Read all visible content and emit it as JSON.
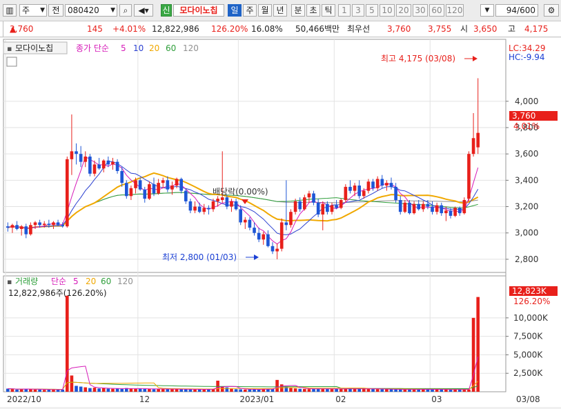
{
  "toolbar": {
    "type_label": "주",
    "prev_label": "전",
    "code": "080420",
    "new_label": "신",
    "stock_name": "모다이노칩",
    "periods": [
      "일",
      "주",
      "월",
      "년",
      "분",
      "초",
      "틱"
    ],
    "numbers": [
      "1",
      "3",
      "5",
      "10",
      "20",
      "30",
      "60",
      "120"
    ],
    "count": "94",
    "total": "/600"
  },
  "info": {
    "price": "3,760",
    "change": "145",
    "rate": "+4.01%",
    "volume": "12,822,986",
    "vol_ratio": "126.20%",
    "turnover": "16.08%",
    "amount": "50,466백만",
    "best_label": "최우선",
    "ask": "3,760",
    "bid": "3,755",
    "open_label": "시",
    "open": "3,650",
    "high_label": "고",
    "high": "4,175"
  },
  "price_panel": {
    "legend_name": "모다이노칩",
    "legend_type": "종가 단순",
    "ma_periods": [
      "5",
      "10",
      "20",
      "60",
      "120"
    ],
    "lc": "LC:34.29",
    "hc": "HC:-9.94",
    "max_annotation": "최고 4,175 (03/08)",
    "min_annotation": "최저 2,800 (01/03)",
    "ex_rights": "배당락(0.00%)",
    "current_price": "3,760",
    "current_rate": "4.01%"
  },
  "volume_panel": {
    "legend_name": "거래량",
    "legend_type": "단순",
    "ma_periods": [
      "5",
      "20",
      "60",
      "120"
    ],
    "summary": "12,822,986주(126.20%)",
    "current_volume": "12,823K",
    "current_rate": "126.20%"
  },
  "colors": {
    "up": "#e8201b",
    "down": "#1e56d6",
    "ma5": "#d61ab8",
    "ma10": "#2a3fd0",
    "ma20": "#f0a800",
    "ma60": "#2e9e3a",
    "ma120": "#909090"
  },
  "chart_data": [
    {
      "type": "candlestick",
      "title": "모다이노칩",
      "ylim": [
        2700,
        4350
      ],
      "y_ticks": [
        2800,
        3000,
        3200,
        3400,
        3600,
        3800,
        4000
      ],
      "y_tick_labels": [
        "2,800",
        "3,000",
        "3,200",
        "3,400",
        "3,600",
        "3,800",
        "4,000"
      ],
      "x_ticks": [
        "2022/10",
        "12",
        "2023/01",
        "02",
        "03",
        "03/08"
      ],
      "grid": true,
      "candles": [
        {
          "o": 3050,
          "h": 3080,
          "l": 3010,
          "c": 3040
        },
        {
          "o": 3040,
          "h": 3070,
          "l": 3000,
          "c": 3060
        },
        {
          "o": 3060,
          "h": 3090,
          "l": 3020,
          "c": 3030
        },
        {
          "o": 3030,
          "h": 3060,
          "l": 2980,
          "c": 3050
        },
        {
          "o": 3050,
          "h": 3070,
          "l": 2960,
          "c": 2990
        },
        {
          "o": 2990,
          "h": 3080,
          "l": 2980,
          "c": 3060
        },
        {
          "o": 3060,
          "h": 3090,
          "l": 3030,
          "c": 3080
        },
        {
          "o": 3080,
          "h": 3100,
          "l": 3040,
          "c": 3060
        },
        {
          "o": 3060,
          "h": 3090,
          "l": 3040,
          "c": 3070
        },
        {
          "o": 3070,
          "h": 3100,
          "l": 3040,
          "c": 3060
        },
        {
          "o": 3060,
          "h": 3090,
          "l": 3030,
          "c": 3080
        },
        {
          "o": 3080,
          "h": 3100,
          "l": 3050,
          "c": 3060
        },
        {
          "o": 3060,
          "h": 3080,
          "l": 3040,
          "c": 3050
        },
        {
          "o": 3050,
          "h": 3580,
          "l": 3040,
          "c": 3560
        },
        {
          "o": 3560,
          "h": 3900,
          "l": 3440,
          "c": 3620
        },
        {
          "o": 3620,
          "h": 3680,
          "l": 3520,
          "c": 3600
        },
        {
          "o": 3600,
          "h": 3660,
          "l": 3500,
          "c": 3540
        },
        {
          "o": 3540,
          "h": 3620,
          "l": 3500,
          "c": 3580
        },
        {
          "o": 3580,
          "h": 3600,
          "l": 3430,
          "c": 3450
        },
        {
          "o": 3450,
          "h": 3550,
          "l": 3430,
          "c": 3520
        },
        {
          "o": 3520,
          "h": 3570,
          "l": 3480,
          "c": 3490
        },
        {
          "o": 3490,
          "h": 3560,
          "l": 3460,
          "c": 3550
        },
        {
          "o": 3550,
          "h": 3580,
          "l": 3500,
          "c": 3520
        },
        {
          "o": 3520,
          "h": 3570,
          "l": 3480,
          "c": 3540
        },
        {
          "o": 3540,
          "h": 3560,
          "l": 3450,
          "c": 3470
        },
        {
          "o": 3470,
          "h": 3500,
          "l": 3350,
          "c": 3380
        },
        {
          "o": 3380,
          "h": 3400,
          "l": 3260,
          "c": 3280
        },
        {
          "o": 3280,
          "h": 3360,
          "l": 3250,
          "c": 3340
        },
        {
          "o": 3340,
          "h": 3420,
          "l": 3300,
          "c": 3400
        },
        {
          "o": 3400,
          "h": 3420,
          "l": 3320,
          "c": 3330
        },
        {
          "o": 3330,
          "h": 3350,
          "l": 3230,
          "c": 3260
        },
        {
          "o": 3260,
          "h": 3390,
          "l": 3250,
          "c": 3370
        },
        {
          "o": 3370,
          "h": 3420,
          "l": 3280,
          "c": 3300
        },
        {
          "o": 3300,
          "h": 3410,
          "l": 3290,
          "c": 3380
        },
        {
          "o": 3380,
          "h": 3420,
          "l": 3340,
          "c": 3400
        },
        {
          "o": 3400,
          "h": 3430,
          "l": 3310,
          "c": 3330
        },
        {
          "o": 3330,
          "h": 3390,
          "l": 3290,
          "c": 3360
        },
        {
          "o": 3360,
          "h": 3420,
          "l": 3340,
          "c": 3410
        },
        {
          "o": 3410,
          "h": 3420,
          "l": 3300,
          "c": 3320
        },
        {
          "o": 3320,
          "h": 3340,
          "l": 3220,
          "c": 3240
        },
        {
          "o": 3240,
          "h": 3260,
          "l": 3150,
          "c": 3170
        },
        {
          "o": 3170,
          "h": 3240,
          "l": 3150,
          "c": 3200
        },
        {
          "o": 3200,
          "h": 3230,
          "l": 3150,
          "c": 3160
        },
        {
          "o": 3160,
          "h": 3220,
          "l": 3140,
          "c": 3190
        },
        {
          "o": 3190,
          "h": 3210,
          "l": 3140,
          "c": 3180
        },
        {
          "o": 3180,
          "h": 3260,
          "l": 3160,
          "c": 3240
        },
        {
          "o": 3240,
          "h": 3280,
          "l": 3200,
          "c": 3260
        },
        {
          "o": 3250,
          "h": 3620,
          "l": 3230,
          "c": 3270
        },
        {
          "o": 3270,
          "h": 3290,
          "l": 3180,
          "c": 3200
        },
        {
          "o": 3200,
          "h": 3260,
          "l": 3160,
          "c": 3240
        },
        {
          "o": 3240,
          "h": 3260,
          "l": 3170,
          "c": 3180
        },
        {
          "o": 3180,
          "h": 3210,
          "l": 3060,
          "c": 3080
        },
        {
          "o": 3080,
          "h": 3120,
          "l": 3030,
          "c": 3100
        },
        {
          "o": 3100,
          "h": 3120,
          "l": 3020,
          "c": 3040
        },
        {
          "o": 3040,
          "h": 3080,
          "l": 2980,
          "c": 3000
        },
        {
          "o": 3000,
          "h": 3040,
          "l": 2930,
          "c": 2950
        },
        {
          "o": 2950,
          "h": 3010,
          "l": 2910,
          "c": 2990
        },
        {
          "o": 2990,
          "h": 3020,
          "l": 2890,
          "c": 2900
        },
        {
          "o": 2900,
          "h": 2930,
          "l": 2840,
          "c": 2860
        },
        {
          "o": 2860,
          "h": 2920,
          "l": 2800,
          "c": 2880
        },
        {
          "o": 2880,
          "h": 3110,
          "l": 2860,
          "c": 3080
        },
        {
          "o": 3080,
          "h": 3400,
          "l": 3020,
          "c": 3060
        },
        {
          "o": 3060,
          "h": 3180,
          "l": 3040,
          "c": 3160
        },
        {
          "o": 3160,
          "h": 3260,
          "l": 3140,
          "c": 3240
        },
        {
          "o": 3240,
          "h": 3270,
          "l": 3160,
          "c": 3180
        },
        {
          "o": 3180,
          "h": 3290,
          "l": 3170,
          "c": 3270
        },
        {
          "o": 3270,
          "h": 3320,
          "l": 3230,
          "c": 3300
        },
        {
          "o": 3300,
          "h": 3320,
          "l": 3210,
          "c": 3230
        },
        {
          "o": 3230,
          "h": 3260,
          "l": 3120,
          "c": 3140
        },
        {
          "o": 3140,
          "h": 3240,
          "l": 3020,
          "c": 3220
        },
        {
          "o": 3220,
          "h": 3240,
          "l": 3140,
          "c": 3160
        },
        {
          "o": 3160,
          "h": 3230,
          "l": 3140,
          "c": 3210
        },
        {
          "o": 3210,
          "h": 3250,
          "l": 3180,
          "c": 3190
        },
        {
          "o": 3190,
          "h": 3260,
          "l": 3180,
          "c": 3250
        },
        {
          "o": 3250,
          "h": 3370,
          "l": 3230,
          "c": 3350
        },
        {
          "o": 3350,
          "h": 3400,
          "l": 3300,
          "c": 3320
        },
        {
          "o": 3320,
          "h": 3380,
          "l": 3280,
          "c": 3360
        },
        {
          "o": 3360,
          "h": 3400,
          "l": 3260,
          "c": 3280
        },
        {
          "o": 3280,
          "h": 3340,
          "l": 3260,
          "c": 3320
        },
        {
          "o": 3320,
          "h": 3410,
          "l": 3300,
          "c": 3390
        },
        {
          "o": 3390,
          "h": 3410,
          "l": 3320,
          "c": 3340
        },
        {
          "o": 3340,
          "h": 3430,
          "l": 3320,
          "c": 3410
        },
        {
          "o": 3410,
          "h": 3440,
          "l": 3340,
          "c": 3360
        },
        {
          "o": 3360,
          "h": 3400,
          "l": 3320,
          "c": 3380
        },
        {
          "o": 3380,
          "h": 3420,
          "l": 3330,
          "c": 3350
        },
        {
          "o": 3350,
          "h": 3380,
          "l": 3230,
          "c": 3250
        },
        {
          "o": 3250,
          "h": 3280,
          "l": 3140,
          "c": 3160
        },
        {
          "o": 3160,
          "h": 3250,
          "l": 3150,
          "c": 3230
        },
        {
          "o": 3230,
          "h": 3250,
          "l": 3140,
          "c": 3150
        },
        {
          "o": 3150,
          "h": 3240,
          "l": 3140,
          "c": 3220
        },
        {
          "o": 3220,
          "h": 3250,
          "l": 3170,
          "c": 3180
        },
        {
          "o": 3180,
          "h": 3240,
          "l": 3160,
          "c": 3220
        },
        {
          "o": 3220,
          "h": 3250,
          "l": 3180,
          "c": 3200
        },
        {
          "o": 3200,
          "h": 3240,
          "l": 3140,
          "c": 3160
        },
        {
          "o": 3160,
          "h": 3230,
          "l": 3140,
          "c": 3210
        },
        {
          "o": 3210,
          "h": 3230,
          "l": 3130,
          "c": 3150
        },
        {
          "o": 3150,
          "h": 3200,
          "l": 3090,
          "c": 3170
        },
        {
          "o": 3170,
          "h": 3190,
          "l": 3110,
          "c": 3130
        },
        {
          "o": 3130,
          "h": 3200,
          "l": 3120,
          "c": 3190
        },
        {
          "o": 3190,
          "h": 3200,
          "l": 3130,
          "c": 3150
        },
        {
          "o": 3150,
          "h": 3270,
          "l": 3140,
          "c": 3250
        },
        {
          "o": 3260,
          "h": 3620,
          "l": 3240,
          "c": 3600
        },
        {
          "o": 3600,
          "h": 3910,
          "l": 3580,
          "c": 3720
        },
        {
          "o": 3650,
          "h": 4175,
          "l": 3600,
          "c": 3760
        }
      ]
    },
    {
      "type": "bar",
      "title": "거래량",
      "y_ticks": [
        2500,
        5000,
        7500,
        10000
      ],
      "y_tick_labels": [
        "2,500K",
        "5,000K",
        "7,500K",
        "10,000K"
      ],
      "ylim": [
        0,
        14000
      ],
      "values": [
        420,
        380,
        300,
        350,
        400,
        380,
        300,
        280,
        260,
        300,
        320,
        280,
        300,
        13000,
        2200,
        800,
        700,
        600,
        500,
        550,
        450,
        480,
        420,
        400,
        450,
        380,
        500,
        430,
        400,
        420,
        380,
        390,
        350,
        380,
        400,
        360,
        350,
        330,
        340,
        350,
        330,
        310,
        320,
        330,
        350,
        380,
        1500,
        700,
        600,
        400,
        350,
        330,
        300,
        320,
        360,
        300,
        400,
        350,
        380,
        1600,
        1000,
        700,
        500,
        450,
        400,
        380,
        360,
        390,
        420,
        400,
        380,
        370,
        390,
        380,
        420,
        400,
        380,
        390,
        410,
        400,
        380,
        360,
        350,
        330,
        340,
        320,
        300,
        310,
        330,
        340,
        320,
        330,
        340,
        310,
        330,
        320,
        300,
        290,
        310,
        320,
        330,
        300,
        10000,
        12823
      ]
    }
  ]
}
